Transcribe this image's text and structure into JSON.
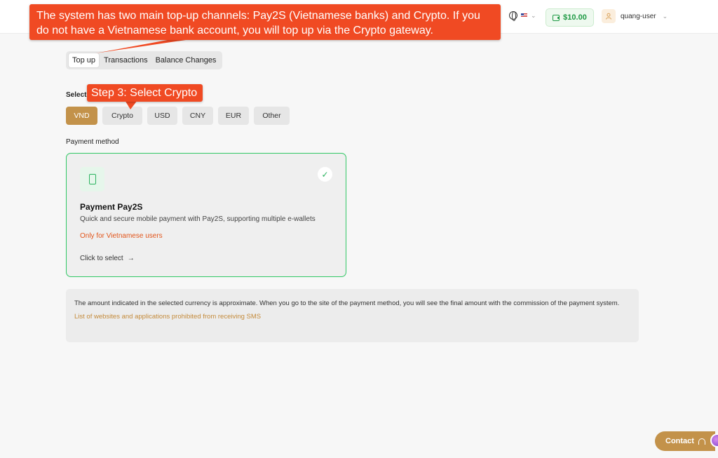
{
  "header": {
    "language_flag": "us-flag",
    "balance": "$10.00",
    "username": "quang-user"
  },
  "annotations": {
    "main_callout": "The system has two main top-up channels: Pay2S (Vietnamese banks) and Crypto. If you do not have a Vietnamese bank account, you will top up via the Crypto gateway.",
    "step_callout": "Step 3: Select Crypto",
    "color": "#f04a23"
  },
  "tabs": [
    {
      "label": "Top up",
      "active": true
    },
    {
      "label": "Transactions",
      "active": false
    },
    {
      "label": "Balance Changes",
      "active": false
    }
  ],
  "currency_section": {
    "label": "Select",
    "options": [
      "VND",
      "Crypto",
      "USD",
      "CNY",
      "EUR",
      "Other"
    ],
    "selected": "VND"
  },
  "payment_method": {
    "label": "Payment method",
    "card": {
      "icon": "phone-icon",
      "title": "Payment Pay2S",
      "description": "Quick and secure mobile payment with Pay2S, supporting multiple e-wallets",
      "note": "Only for Vietnamese users",
      "cta": "Click to select",
      "cta_arrow": "→",
      "checkmark": "✓"
    }
  },
  "info": {
    "text": "The amount indicated in the selected currency is approximate. When you go to the site of the payment method, you will see the final amount with the commission of the payment system.",
    "link": "List of websites and applications prohibited from receiving SMS"
  },
  "contact": {
    "label": "Contact"
  },
  "colors": {
    "accent": "#c3924a",
    "success": "#30c764",
    "warning_text": "#e2551b",
    "balance_green": "#1f9a45"
  }
}
